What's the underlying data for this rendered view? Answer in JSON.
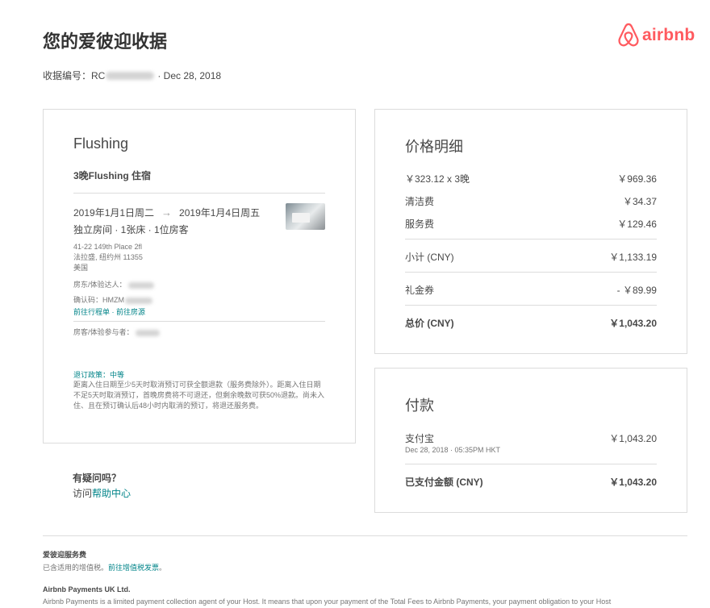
{
  "header": {
    "title": "您的爱彼迎收据",
    "logo_text": "airbnb",
    "receipt_label": "收据编号：RC",
    "receipt_date": "· Dec 28, 2018"
  },
  "brand_color": "#ff5a5f",
  "link_color": "#008489",
  "listing": {
    "city": "Flushing",
    "nights_title": "3晚Flushing 住宿",
    "checkin": "2019年1月1日周二",
    "checkout": "2019年1月4日周五",
    "arrow": "→",
    "room": "独立房间 · 1张床 · 1位房客",
    "address_line1": "41-22 149th Place 2fl",
    "address_line2": "法拉盛, 纽约州 11355",
    "address_line3": "美国",
    "host_label": "房东/体验达人：",
    "conf_label": "确认码：HMZM",
    "link_itinerary": "前往行程单",
    "link_sep": " · ",
    "link_listing": "前往房源",
    "guest_label": "房客/体验参与者：",
    "policy_title": "退订政策：中等",
    "policy_text": "距离入住日期至少5天时取消预订可获全额退款（服务费除外）。距离入住日期不足5天时取消预订，首晚房费将不可退还，但剩余晚数可获50%退款。尚未入住、且在预订确认后48小时内取消的预订，将退还服务费。"
  },
  "questions": {
    "title": "有疑问吗？",
    "prefix": "访问",
    "link": "帮助中心"
  },
  "price": {
    "title": "价格明细",
    "rows": [
      {
        "label": "￥323.12 x 3晚",
        "value": "￥969.36"
      },
      {
        "label": "清洁费",
        "value": "￥34.37"
      },
      {
        "label": "服务费",
        "value": "￥129.46"
      },
      {
        "label": "小计 (CNY)",
        "value": "￥1,133.19"
      },
      {
        "label": "礼金券",
        "value": "- ￥89.99"
      },
      {
        "label": "总价 (CNY)",
        "value": "￥1,043.20"
      }
    ]
  },
  "payment": {
    "title": "付款",
    "method": "支付宝",
    "amount": "￥1,043.20",
    "datetime": "Dec 28, 2018 · 05:35PM HKT",
    "paid_label": "已支付金额 (CNY)",
    "paid_value": "￥1,043.20"
  },
  "footer": {
    "service_title": "爱彼迎服务费",
    "vat_text": "已含适用的增值税。",
    "vat_link": "前往增值税发票",
    "vat_end": "。",
    "company": "Airbnb Payments UK Ltd.",
    "company_text": "Airbnb Payments is a limited payment collection agent of your Host. It means that upon your payment of the Total Fees to Airbnb Payments, your payment obligation to your Host"
  }
}
